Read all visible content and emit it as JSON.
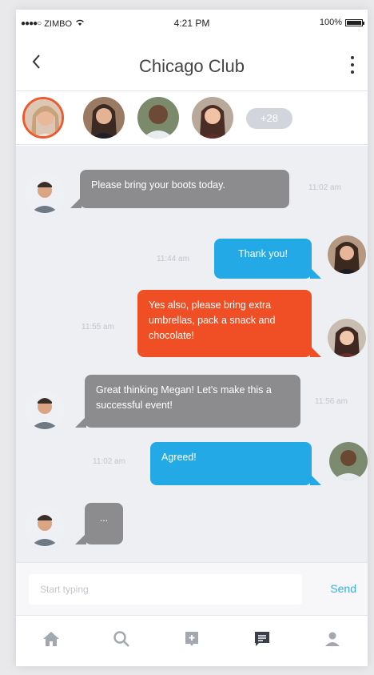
{
  "status_bar": {
    "carrier": "ZIMBO",
    "signal_dots": "●●●●○",
    "wifi_icon": "wifi-icon",
    "time": "4:21 PM",
    "battery": "100%"
  },
  "header": {
    "back_icon": "chevron-left-icon",
    "title": "Chicago Club",
    "more_icon": "more-vertical-icon"
  },
  "members": {
    "avatars": [
      "member-1",
      "member-2",
      "member-3",
      "member-4"
    ],
    "more_count": "+28"
  },
  "messages": [
    {
      "sender": "other",
      "color": "gray",
      "text": "Please bring your boots today.",
      "time": "11:02 am"
    },
    {
      "sender": "self",
      "color": "blue",
      "text": "Thank you!",
      "time": "11:44 am"
    },
    {
      "sender": "self",
      "color": "orange",
      "text": "Yes also, please bring extra umbrellas, pack a snack and chocolate!",
      "time": "11:55 am"
    },
    {
      "sender": "other",
      "color": "gray",
      "text": "Great thinking Megan! Let's make this a successful event!",
      "time": "11:56 am"
    },
    {
      "sender": "self",
      "color": "blue",
      "text": "Agreed!",
      "time": "11:02 am"
    },
    {
      "sender": "other",
      "color": "gray",
      "text": "...",
      "time": ""
    }
  ],
  "input": {
    "placeholder": "Start typing",
    "value": "",
    "send_label": "Send"
  },
  "tabs": [
    {
      "icon": "home-icon"
    },
    {
      "icon": "search-icon"
    },
    {
      "icon": "add-post-icon"
    },
    {
      "icon": "chat-icon",
      "active": true
    },
    {
      "icon": "profile-icon"
    }
  ],
  "colors": {
    "accent_orange": "#f04f25",
    "accent_blue": "#22a9e6",
    "bubble_gray": "#8c8c8f",
    "send_blue": "#34aee8",
    "tab_active": "#3a3f4a",
    "tab_inactive": "#a3a7b0"
  }
}
